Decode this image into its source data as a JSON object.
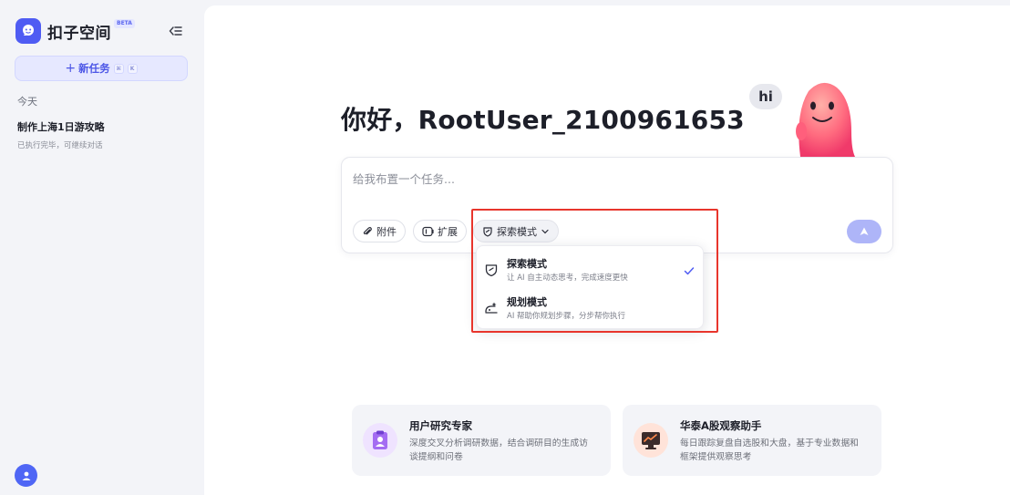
{
  "brand": {
    "name": "扣子空间",
    "badge": "BETA"
  },
  "sidebar": {
    "new_task": {
      "label": "新任务",
      "shortcut_keys": [
        "⌘",
        "K"
      ]
    },
    "section_today": "今天",
    "history": [
      {
        "title": "制作上海1日游攻略",
        "subtitle": "已执行完毕，可继续对话"
      }
    ]
  },
  "main": {
    "greeting": "你好，RootUser_2100961653",
    "mascot_bubble": "hi",
    "composer": {
      "placeholder": "给我布置一个任务...",
      "value": "",
      "chips": {
        "attach": "附件",
        "extension": "扩展",
        "mode": "探索模式"
      }
    },
    "mode_menu": {
      "options": [
        {
          "name": "探索模式",
          "desc": "让 AI 自主动态思考，完成速度更快",
          "selected": true
        },
        {
          "name": "规划模式",
          "desc": "AI 帮助你规划步骤，分步帮你执行",
          "selected": false
        }
      ]
    },
    "agents": [
      {
        "title": "用户研究专家",
        "desc": "深度交叉分析调研数据，结合调研目的生成访谈提纲和问卷"
      },
      {
        "title": "华泰A股观察助手",
        "desc": "每日跟踪复盘自选股和大盘，基于专业数据和框架提供观察思考"
      }
    ]
  },
  "colors": {
    "accent": "#4f5cf3",
    "highlight_border": "#e8352c",
    "send_disabled": "#aeb5f8"
  }
}
